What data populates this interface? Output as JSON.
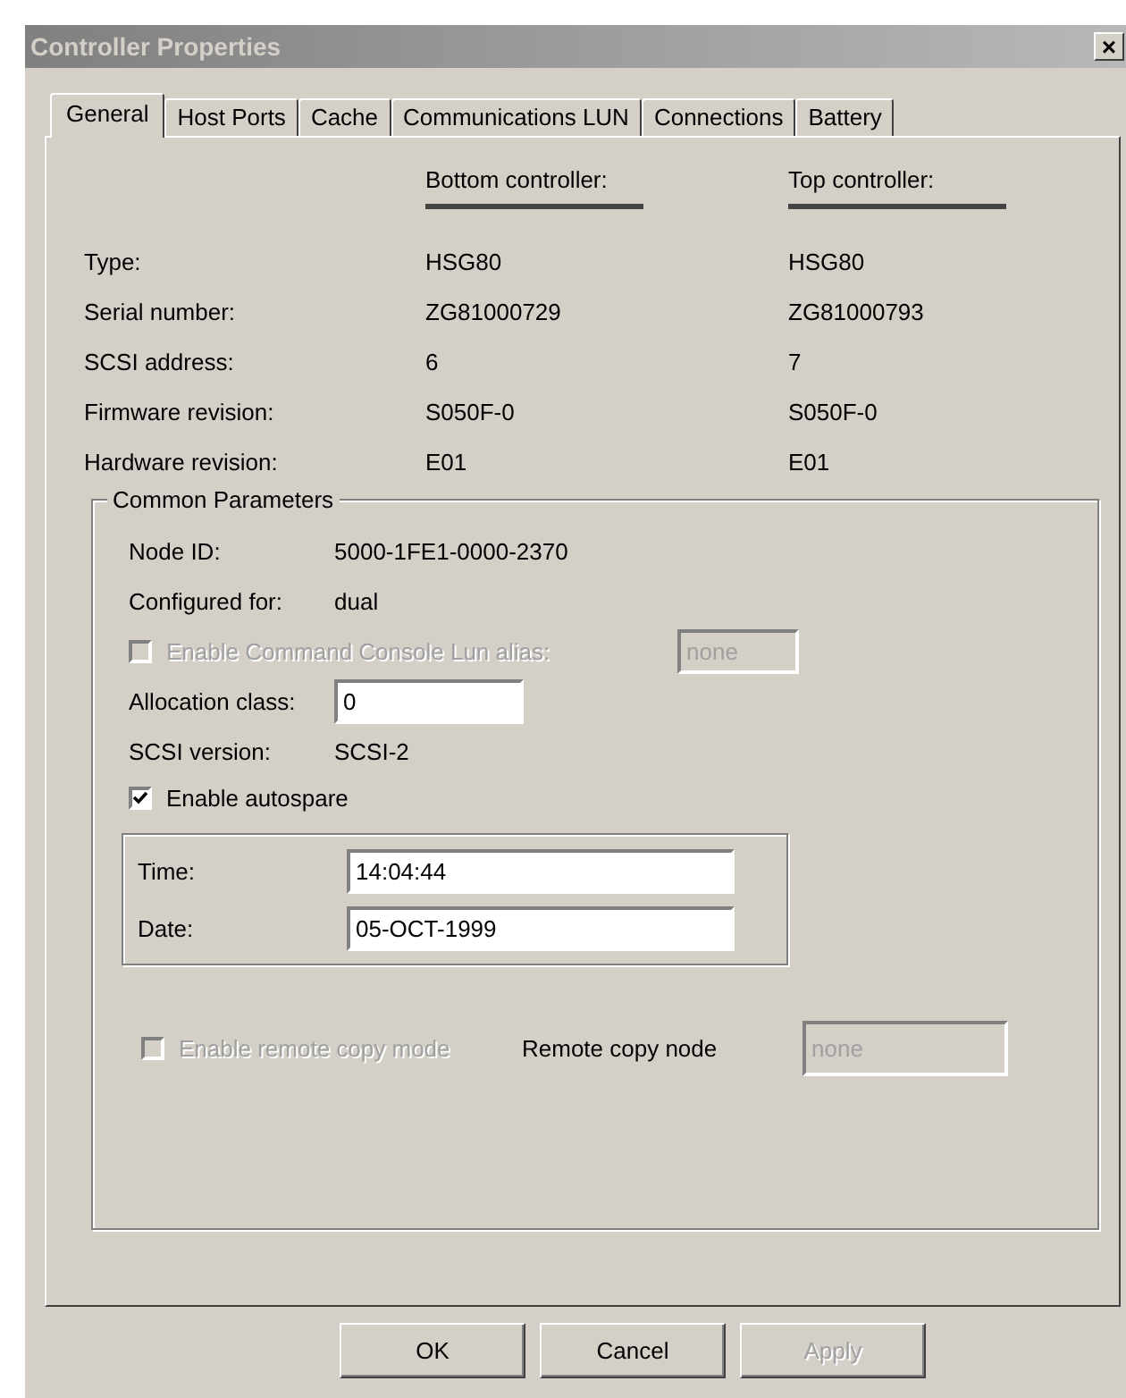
{
  "window": {
    "title": "Controller Properties",
    "close_label": "×"
  },
  "tabs": [
    {
      "label": "General",
      "selected": true
    },
    {
      "label": "Host Ports",
      "selected": false
    },
    {
      "label": "Cache",
      "selected": false
    },
    {
      "label": "Communications LUN",
      "selected": false
    },
    {
      "label": "Connections",
      "selected": false
    },
    {
      "label": "Battery",
      "selected": false
    }
  ],
  "controllers": {
    "columns": [
      "Bottom controller:",
      "Top controller:"
    ],
    "rows": [
      {
        "label": "Type:",
        "values": [
          "HSG80",
          "HSG80"
        ]
      },
      {
        "label": "Serial number:",
        "values": [
          "ZG81000729",
          "ZG81000793"
        ]
      },
      {
        "label": "SCSI address:",
        "values": [
          "6",
          "7"
        ]
      },
      {
        "label": "Firmware revision:",
        "values": [
          "S050F-0",
          "S050F-0"
        ]
      },
      {
        "label": "Hardware revision:",
        "values": [
          "E01",
          "E01"
        ]
      }
    ]
  },
  "common_parameters": {
    "title": "Common Parameters",
    "node_id": {
      "label": "Node ID:",
      "value": "5000-1FE1-0000-2370"
    },
    "configured_for": {
      "label": "Configured for:",
      "value": "dual"
    },
    "console_alias": {
      "label": "Enable Command Console Lun alias:",
      "checked": false,
      "disabled": true,
      "value": "none"
    },
    "allocation_class": {
      "label": "Allocation class:",
      "value": "0"
    },
    "scsi_version": {
      "label": "SCSI version:",
      "value": "SCSI-2"
    },
    "autospare": {
      "label": "Enable autospare",
      "checked": true,
      "disabled": false
    },
    "clock": [
      {
        "label": "Time:",
        "value": "14:04:44"
      },
      {
        "label": "Date:",
        "value": "05-OCT-1999"
      }
    ],
    "remote_copy": {
      "label": "Enable remote copy mode",
      "checked": false,
      "disabled": true
    },
    "remote_copy_node": {
      "label": "Remote copy node",
      "value": "none",
      "disabled": true
    }
  },
  "buttons": [
    {
      "label": "OK",
      "disabled": false
    },
    {
      "label": "Cancel",
      "disabled": false
    },
    {
      "label": "Apply",
      "disabled": true
    }
  ]
}
